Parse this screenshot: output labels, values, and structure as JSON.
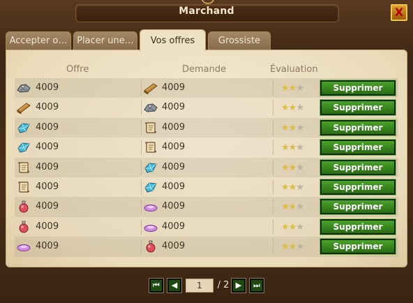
{
  "window": {
    "title": "Marchand",
    "close_label": "X"
  },
  "tabs": [
    {
      "label": "Accepter o…",
      "active": false
    },
    {
      "label": "Placer une…",
      "active": false
    },
    {
      "label": "Vos offres",
      "active": true
    },
    {
      "label": "Grossiste",
      "active": false
    }
  ],
  "columns": {
    "offer": "Offre",
    "demand": "Demande",
    "rating": "Évaluation"
  },
  "rows": [
    {
      "offer_icon": "silver-ore-icon",
      "offer_amount": "4009",
      "demand_icon": "wood-plank-icon",
      "demand_amount": "4009",
      "rating": 2,
      "rating_max": 3,
      "action": "Supprimer"
    },
    {
      "offer_icon": "wood-plank-icon",
      "offer_amount": "4009",
      "demand_icon": "silver-ore-icon",
      "demand_amount": "4009",
      "rating": 2,
      "rating_max": 3,
      "action": "Supprimer"
    },
    {
      "offer_icon": "blue-crystal-icon",
      "offer_amount": "4009",
      "demand_icon": "scroll-icon",
      "demand_amount": "4009",
      "rating": 2,
      "rating_max": 3,
      "action": "Supprimer"
    },
    {
      "offer_icon": "blue-crystal-icon",
      "offer_amount": "4009",
      "demand_icon": "scroll-icon",
      "demand_amount": "4009",
      "rating": 2,
      "rating_max": 3,
      "action": "Supprimer"
    },
    {
      "offer_icon": "scroll-icon",
      "offer_amount": "4009",
      "demand_icon": "blue-crystal-icon",
      "demand_amount": "4009",
      "rating": 2,
      "rating_max": 3,
      "action": "Supprimer"
    },
    {
      "offer_icon": "scroll-icon",
      "offer_amount": "4009",
      "demand_icon": "blue-crystal-icon",
      "demand_amount": "4009",
      "rating": 2,
      "rating_max": 3,
      "action": "Supprimer"
    },
    {
      "offer_icon": "red-potion-icon",
      "offer_amount": "4009",
      "demand_icon": "pink-gem-icon",
      "demand_amount": "4009",
      "rating": 2,
      "rating_max": 3,
      "action": "Supprimer"
    },
    {
      "offer_icon": "red-potion-icon",
      "offer_amount": "4009",
      "demand_icon": "pink-gem-icon",
      "demand_amount": "4009",
      "rating": 2,
      "rating_max": 3,
      "action": "Supprimer"
    },
    {
      "offer_icon": "pink-gem-icon",
      "offer_amount": "4009",
      "demand_icon": "red-potion-icon",
      "demand_amount": "4009",
      "rating": 2,
      "rating_max": 3,
      "action": "Supprimer"
    }
  ],
  "pagination": {
    "current_page": "1",
    "total": "/ 2"
  },
  "colors": {
    "accent_green": "#2f7a18",
    "star": "#dcbc45",
    "close_red": "#b90000"
  }
}
